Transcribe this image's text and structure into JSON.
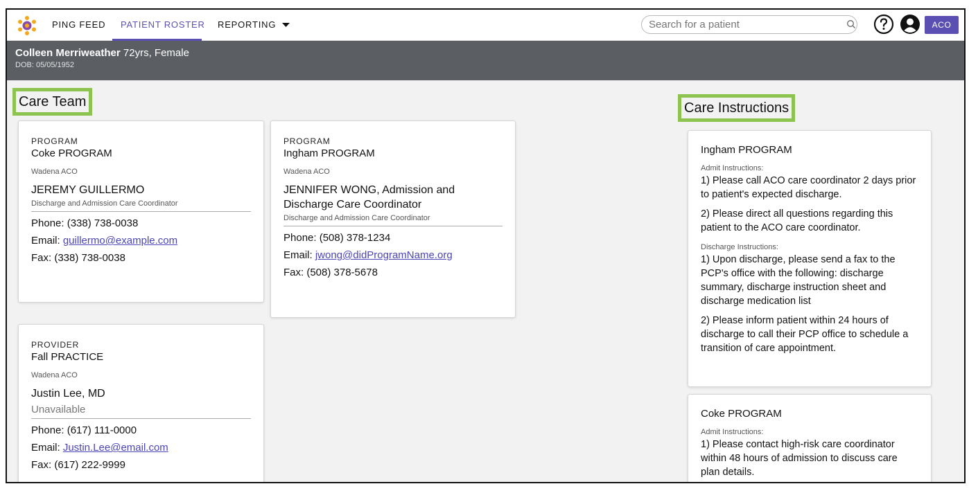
{
  "nav": {
    "items": [
      "PING FEED",
      "PATIENT ROSTER",
      "REPORTING"
    ],
    "active": "PATIENT ROSTER",
    "search_placeholder": "Search for a patient",
    "badge": "ACO",
    "accent_color": "#5b4fb3"
  },
  "patient": {
    "name": "Colleen Merriweather",
    "summary": "72yrs, Female",
    "dob": "DOB: 05/05/1952"
  },
  "care_team": {
    "title": "Care Team",
    "cards": [
      {
        "caption": "PROGRAM",
        "program": "Coke PROGRAM",
        "org": "Wadena ACO",
        "contact": "JEREMY GUILLERMO",
        "role": "Discharge and Admission Care Coordinator",
        "phone": "Phone: (338) 738-0038",
        "email_label": "Email: ",
        "email": "guillermo@example.com",
        "fax": "Fax: (338) 738-0038"
      },
      {
        "caption": "PROGRAM",
        "program": "Ingham PROGRAM",
        "org": "Wadena ACO",
        "contact": "JENNIFER WONG, Admission and Discharge Care Coordinator",
        "role": "Discharge and Admission Care Coordinator",
        "phone": "Phone: (508) 378-1234",
        "email_label": "Email: ",
        "email": "jwong@didProgramName.org",
        "fax": "Fax: (508) 378-5678"
      },
      {
        "caption": "PROVIDER",
        "program": "Fall PRACTICE",
        "org": "Wadena ACO",
        "contact": "Justin Lee, MD",
        "status": "Unavailable",
        "phone": "Phone: (617) 111-0000",
        "email_label": "Email: ",
        "email": "Justin.Lee@email.com",
        "fax": "Fax: (617) 222-9999"
      }
    ]
  },
  "care_instructions": {
    "title": "Care Instructions",
    "cards": [
      {
        "program": "Ingham PROGRAM",
        "admit_label": "Admit Instructions:",
        "admit": [
          "1) Please call ACO care coordinator 2 days prior to patient's expected discharge.",
          "2) Please direct all questions regarding this patient to the ACO care coordinator."
        ],
        "discharge_label": "Discharge Instructions:",
        "discharge": [
          "1) Upon discharge, please send a fax to the PCP's office with the following: discharge summary, discharge instruction sheet and discharge medication list",
          "2) Please inform patient within 24 hours of discharge to call their PCP office to schedule a transition of care appointment."
        ]
      },
      {
        "program": "Coke PROGRAM",
        "admit_label": "Admit Instructions:",
        "admit": [
          "1) Please contact high-risk care coordinator within 48 hours of admission to discuss care plan details."
        ]
      }
    ]
  }
}
